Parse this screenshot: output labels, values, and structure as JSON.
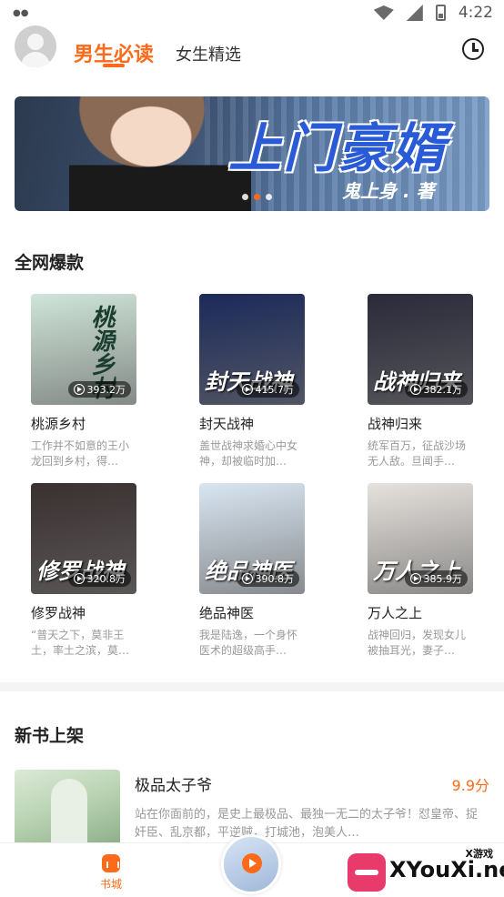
{
  "status_bar": {
    "left_icon": "notification-icon",
    "time": "4:22"
  },
  "header": {
    "tabs": [
      "男生必读",
      "女生精选"
    ],
    "active_tab": 0
  },
  "banner": {
    "title": "上门豪婿",
    "author_line": "鬼上身 . 著",
    "slide_count": 3,
    "active_slide": 1
  },
  "sections": {
    "hot": "全网爆款",
    "new": "新书上架"
  },
  "hot_books": [
    {
      "name": "桃源乡村",
      "cover_title": "桃源乡村",
      "plays": "393.2万",
      "desc": "工作并不如意的王小龙回到乡村，得…",
      "cover_color": "#cfe5d9"
    },
    {
      "name": "封天战神",
      "cover_title": "封天战神",
      "plays": "415.7万",
      "desc": "盖世战神求婚心中女神，却被临时加…",
      "cover_color": "#1c2a5a"
    },
    {
      "name": "战神归来",
      "cover_title": "战神归来",
      "plays": "382.1万",
      "desc": "统军百万，征战沙场无人敌。旦闻手…",
      "cover_color": "#2a2a3a"
    },
    {
      "name": "修罗战神",
      "cover_title": "修罗战神",
      "plays": "320.8万",
      "desc": "“普天之下，莫非王土，率土之滨，莫…",
      "cover_color": "#3a3030"
    },
    {
      "name": "绝品神医",
      "cover_title": "绝品神医",
      "plays": "390.8万",
      "desc": "我是陆逸，一个身怀医术的超级高手…",
      "cover_color": "#d9e6f2"
    },
    {
      "name": "万人之上",
      "cover_title": "万人之上",
      "plays": "385.9万",
      "desc": "战神回归，发现女儿被抽耳光，妻子…",
      "cover_color": "#e6e2de"
    }
  ],
  "new_book": {
    "name": "极品太子爷",
    "score": "9.9分",
    "desc": "站在你面前的，是史上最极品、最独一无二的太子爷！怼皇帝、捉奸臣、乱京都，平逆贼，打城池，泡美人…"
  },
  "bottom_nav": {
    "home_label": "书城"
  },
  "watermark": {
    "text": "XYouXi.net",
    "sub": "X游戏"
  },
  "colors": {
    "accent": "#ff6a1a"
  }
}
